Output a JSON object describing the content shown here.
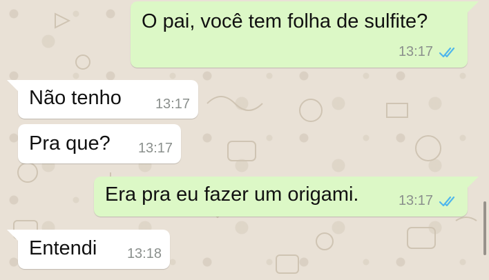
{
  "chat": {
    "messages": [
      {
        "direction": "out",
        "text": "O pai, você tem folha de sulfite?",
        "time": "13:17",
        "status_icon": "double-check-read-icon"
      },
      {
        "direction": "in",
        "text": "Não tenho",
        "time": "13:17"
      },
      {
        "direction": "in",
        "text": "Pra que?",
        "time": "13:17"
      },
      {
        "direction": "out",
        "text": "Era pra eu fazer um origami.",
        "time": "13:17",
        "status_icon": "double-check-read-icon"
      },
      {
        "direction": "in",
        "text": "Entendi",
        "time": "13:18"
      }
    ]
  },
  "colors": {
    "outgoing_bubble": "#dcf8c6",
    "incoming_bubble": "#ffffff",
    "read_ticks": "#4fb6ec",
    "wallpaper": "#e9e1d6"
  }
}
